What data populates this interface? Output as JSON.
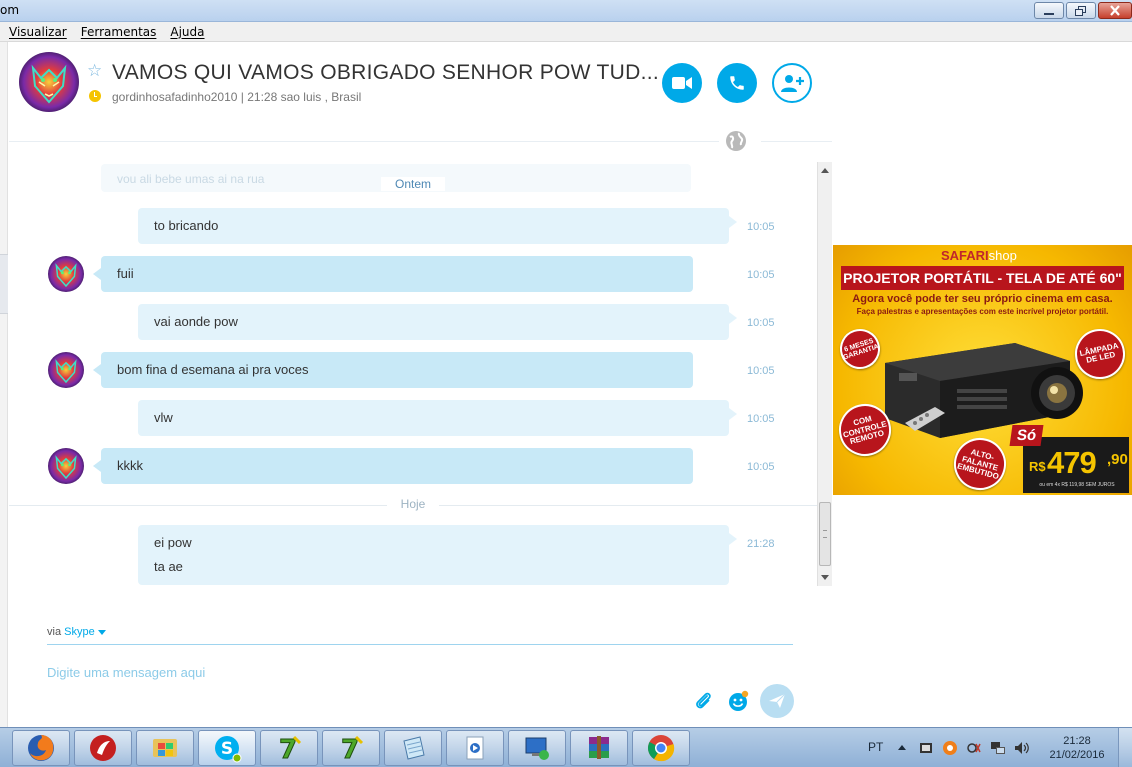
{
  "window": {
    "title": "om",
    "controls": {
      "minimize": "minimize-icon",
      "maximize": "restore-icon",
      "close": "close-icon"
    }
  },
  "menu": [
    "Visualizar",
    "Ferramentas",
    "Ajuda"
  ],
  "conversation": {
    "title": "VAMOS QUI VAMOS OBRIGADO SENHOR POW TUD...",
    "subtitle": "gordinhosafadinho2010  |  21:28 sao luis , Brasil",
    "actions": {
      "video": "video-call-icon",
      "call": "phone-icon",
      "add": "add-contact-icon"
    }
  },
  "messages": {
    "faded_preview": "vou ali bebe umas ai na rua",
    "day_yesterday": "Ontem",
    "day_today": "Hoje",
    "items": [
      {
        "sender": "me",
        "text": "to bricando",
        "time": "10:05"
      },
      {
        "sender": "other",
        "text": "fuii",
        "time": "10:05"
      },
      {
        "sender": "me",
        "text": "vai aonde pow",
        "time": "10:05"
      },
      {
        "sender": "other",
        "text": "bom fina d esemana ai pra voces",
        "time": "10:05"
      },
      {
        "sender": "me",
        "text": "vlw",
        "time": "10:05"
      },
      {
        "sender": "other",
        "text": "kkkk",
        "time": "10:05"
      }
    ],
    "today_item": {
      "sender": "me",
      "line1": "ei pow",
      "line2": "ta ae",
      "time": "21:28"
    }
  },
  "compose": {
    "via_label": "via",
    "via_service": "Skype",
    "placeholder": "Digite uma mensagem aqui"
  },
  "ad": {
    "brand_a": "SAFARI",
    "brand_b": "shop",
    "headline": "PROJETOR PORTÁTIL - TELA DE ATÉ 60\"",
    "tagline1": "Agora você pode ter seu próprio cinema em casa.",
    "tagline2": "Faça palestras e apresentações com este incrível projetor portátil.",
    "seal_warranty": "6 MESES GARANTIA",
    "seal_led": "LÂMPADA DE LED",
    "seal_remote": "COM CONTROLE REMOTO",
    "seal_speaker": "ALTO-FALANTE EMBUTIDO",
    "price_prefix": "Só",
    "currency": "R$",
    "price_int": "479",
    "price_cents": ",90",
    "terms": "ou em 4x R$ 119,98   SEM JUROS"
  },
  "taskbar": {
    "apps": [
      "firefox-icon",
      "app-red-icon",
      "windows-explorer-icon",
      "skype-icon",
      "app-seven-icon",
      "app-seven-icon",
      "notepad-icon",
      "media-player-icon",
      "remote-desktop-icon",
      "winrar-icon",
      "chrome-icon"
    ],
    "language": "PT",
    "time": "21:28",
    "date": "21/02/2016"
  }
}
